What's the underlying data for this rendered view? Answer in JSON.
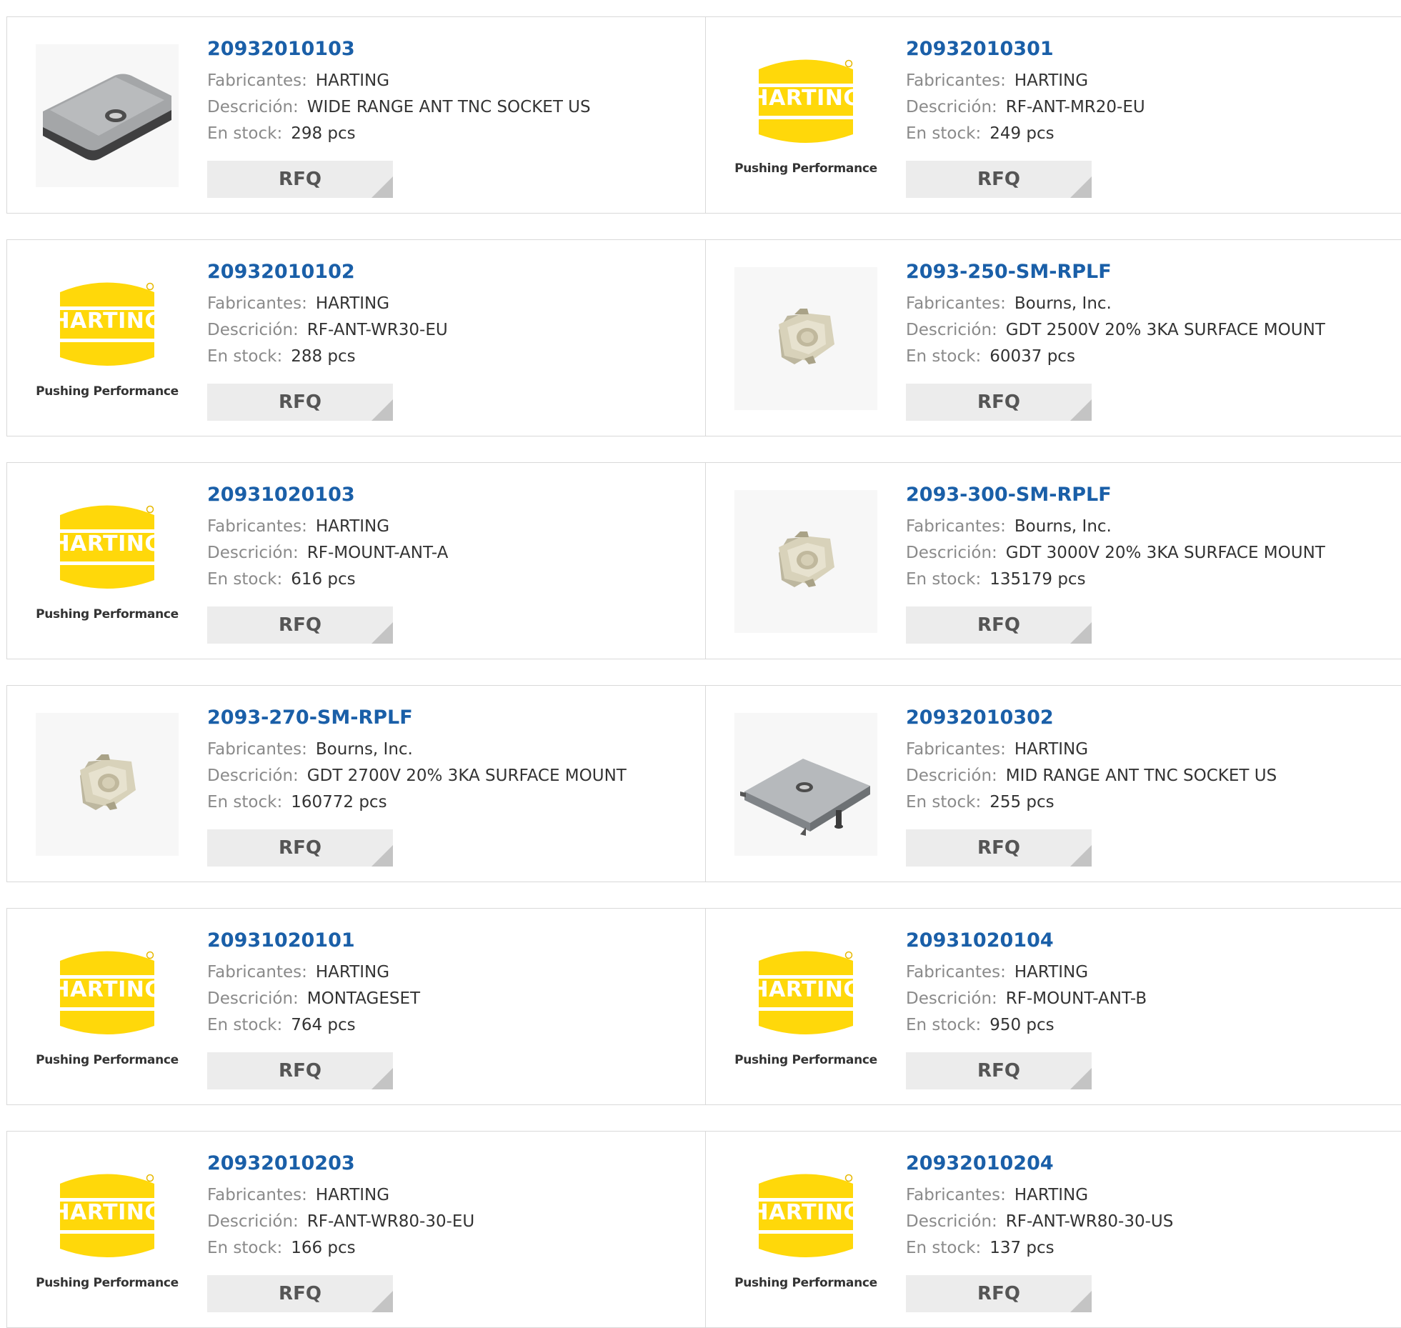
{
  "labels": {
    "manufacturer": "Fabricantes:",
    "description": "Descrición:",
    "stock": "En stock:",
    "rfq": "RFQ"
  },
  "logo": {
    "word": "HARTING",
    "tagline": "Pushing Performance",
    "colors": {
      "yellow": "#ffd80a",
      "text": "#333333"
    }
  },
  "colors": {
    "part_number": "#1a5fa8",
    "label": "#8a8a8a",
    "value": "#333333",
    "rfq_bg": "#ececec",
    "border": "#d9d9d9"
  },
  "products": [
    {
      "part_number": "20932010103",
      "manufacturer": "HARTING",
      "description": "WIDE RANGE ANT TNC SOCKET US",
      "stock": "298 pcs",
      "image": "antenna-flat-icon"
    },
    {
      "part_number": "20932010301",
      "manufacturer": "HARTING",
      "description": "RF-ANT-MR20-EU",
      "stock": "249 pcs",
      "image": "harting-logo"
    },
    {
      "part_number": "20932010102",
      "manufacturer": "HARTING",
      "description": "RF-ANT-WR30-EU",
      "stock": "288 pcs",
      "image": "harting-logo"
    },
    {
      "part_number": "2093-250-SM-RPLF",
      "manufacturer": "Bourns, Inc.",
      "description": "GDT 2500V 20% 3KA SURFACE MOUNT",
      "stock": "60037 pcs",
      "image": "gdt-component-icon"
    },
    {
      "part_number": "20931020103",
      "manufacturer": "HARTING",
      "description": "RF-MOUNT-ANT-A",
      "stock": "616 pcs",
      "image": "harting-logo"
    },
    {
      "part_number": "2093-300-SM-RPLF",
      "manufacturer": "Bourns, Inc.",
      "description": "GDT 3000V 20% 3KA SURFACE MOUNT",
      "stock": "135179 pcs",
      "image": "gdt-component-icon"
    },
    {
      "part_number": "2093-270-SM-RPLF",
      "manufacturer": "Bourns, Inc.",
      "description": "GDT 2700V 20% 3KA SURFACE MOUNT",
      "stock": "160772 pcs",
      "image": "gdt-component-icon"
    },
    {
      "part_number": "20932010302",
      "manufacturer": "HARTING",
      "description": "MID RANGE ANT TNC SOCKET US",
      "stock": "255 pcs",
      "image": "antenna-box-icon"
    },
    {
      "part_number": "20931020101",
      "manufacturer": "HARTING",
      "description": "MONTAGESET",
      "stock": "764 pcs",
      "image": "harting-logo"
    },
    {
      "part_number": "20931020104",
      "manufacturer": "HARTING",
      "description": "RF-MOUNT-ANT-B",
      "stock": "950 pcs",
      "image": "harting-logo"
    },
    {
      "part_number": "20932010203",
      "manufacturer": "HARTING",
      "description": "RF-ANT-WR80-30-EU",
      "stock": "166 pcs",
      "image": "harting-logo"
    },
    {
      "part_number": "20932010204",
      "manufacturer": "HARTING",
      "description": "RF-ANT-WR80-30-US",
      "stock": "137 pcs",
      "image": "harting-logo"
    }
  ]
}
